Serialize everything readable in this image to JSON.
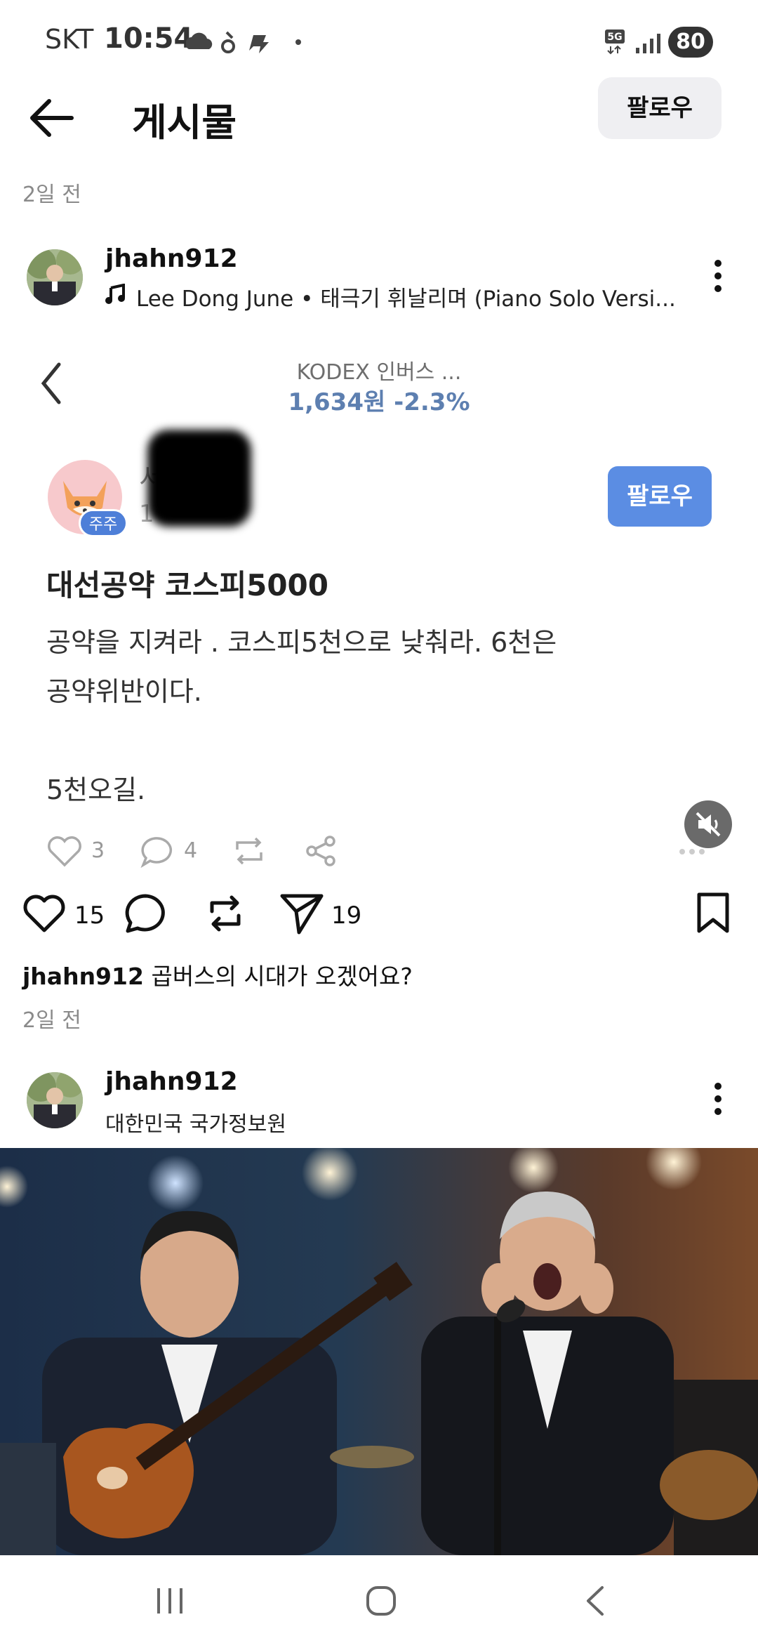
{
  "status_bar": {
    "carrier": "SKT",
    "time": "10:54",
    "network": "5G",
    "battery": "80"
  },
  "header": {
    "title": "게시물",
    "follow_label": "팔로우"
  },
  "post1": {
    "time": "2일 전",
    "username": "jhahn912",
    "music": "Lee Dong June • 태극기 휘날리며 (Piano Solo Versi...",
    "embed": {
      "stock_name": "KODEX 인버스 ...",
      "stock_price": "1,634원 -2.3%",
      "author_fragment": "서",
      "date_fragment": "1",
      "badge": "주주",
      "follow_label": "팔로우",
      "title": "대선공약 코스피5000",
      "body": "공약을 지켜라 .  코스피5천으로 낮춰라. 6천은\n공약위반이다.\n\n5천오길.",
      "likes": "3",
      "comments": "4"
    },
    "actions": {
      "likes": "15",
      "shares": "19"
    },
    "caption_user": "jhahn912",
    "caption_text": "곱버스의 시대가 오겠어요?",
    "caption_time": "2일 전"
  },
  "post2": {
    "username": "jhahn912",
    "location": "대한민국 국가정보원"
  },
  "icons": {
    "back": "back-arrow-icon",
    "more": "kebab-icon",
    "music": "music-note-icon",
    "heart": "heart-icon",
    "comment": "comment-icon",
    "repost": "repost-icon",
    "send": "send-icon",
    "bookmark": "bookmark-icon"
  },
  "colors": {
    "accent_blue": "#5b8de3",
    "price_blue": "#5d7fb0",
    "muted": "#8a8a8a"
  }
}
